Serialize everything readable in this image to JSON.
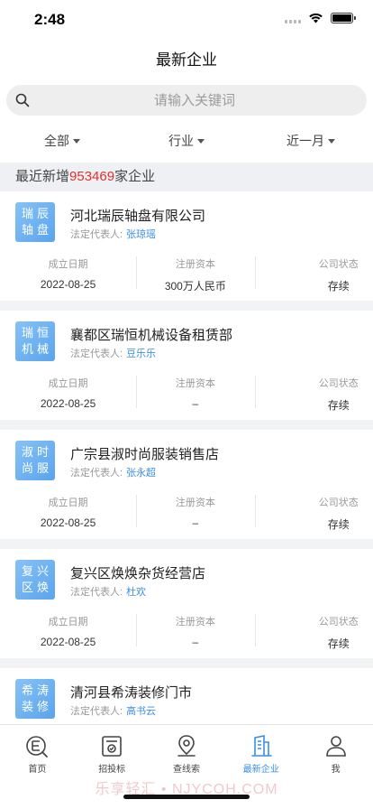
{
  "status_bar": {
    "time": "2:48"
  },
  "nav": {
    "title": "最新企业"
  },
  "search": {
    "placeholder": "请输入关键词"
  },
  "filters": [
    {
      "label": "全部"
    },
    {
      "label": "行业"
    },
    {
      "label": "近一月"
    }
  ],
  "summary": {
    "prefix": "最近新增",
    "count": "953469",
    "suffix": "家企业"
  },
  "labels": {
    "legal_rep": "法定代表人:",
    "founded": "成立日期",
    "capital": "注册资本",
    "status": "公司状态"
  },
  "companies": [
    {
      "logo_top": "瑞辰",
      "logo_bottom": "轴盘",
      "name": "河北瑞辰轴盘有限公司",
      "legal_person": "张琼瑶",
      "founded": "2022-08-25",
      "capital": "300万人民币",
      "status": "存续"
    },
    {
      "logo_top": "瑞恒",
      "logo_bottom": "机械",
      "name": "襄都区瑞恒机械设备租赁部",
      "legal_person": "豆乐乐",
      "founded": "2022-08-25",
      "capital": "–",
      "status": "存续"
    },
    {
      "logo_top": "淑时",
      "logo_bottom": "尚服",
      "name": "广宗县淑时尚服装销售店",
      "legal_person": "张永超",
      "founded": "2022-08-25",
      "capital": "–",
      "status": "存续"
    },
    {
      "logo_top": "复兴",
      "logo_bottom": "区焕",
      "name": "复兴区焕焕杂货经营店",
      "legal_person": "杜欢",
      "founded": "2022-08-25",
      "capital": "–",
      "status": "存续"
    },
    {
      "logo_top": "希涛",
      "logo_bottom": "装修",
      "name": "清河县希涛装修门市",
      "legal_person": "高书云",
      "founded": "",
      "capital": "",
      "status": ""
    }
  ],
  "tabs": [
    {
      "label": "首页",
      "icon": "home-icon"
    },
    {
      "label": "招投标",
      "icon": "bidding-icon"
    },
    {
      "label": "查线索",
      "icon": "location-pin-icon"
    },
    {
      "label": "最新企业",
      "icon": "building-icon",
      "active": true
    },
    {
      "label": "我",
      "icon": "user-icon"
    }
  ],
  "watermark": "乐享轻汇 • NJYCOH.COM",
  "colors": {
    "accent": "#3a8ee6",
    "highlight": "#e0302e",
    "logo_gradient": "#6aaff0"
  }
}
